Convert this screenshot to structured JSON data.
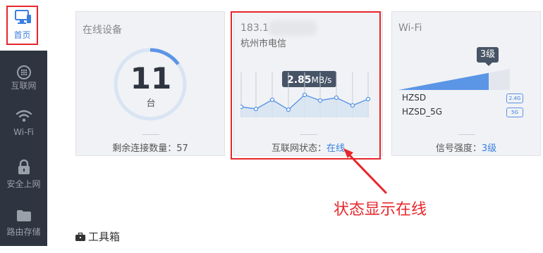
{
  "sidebar": {
    "items": [
      {
        "label": "首页",
        "icon": "monitor-icon",
        "active": true
      },
      {
        "label": "互联网",
        "icon": "globe-icon",
        "active": false
      },
      {
        "label": "Wi-Fi",
        "icon": "wifi-icon",
        "active": false
      },
      {
        "label": "安全上网",
        "icon": "lock-icon",
        "active": false
      },
      {
        "label": "路由存储",
        "icon": "folder-icon",
        "active": false
      }
    ],
    "active_color": "#3a7fe0",
    "background": "#2f3540"
  },
  "devices_card": {
    "title": "在线设备",
    "count": "11",
    "unit": "台",
    "remaining_label": "剩余连接数量：",
    "remaining_value": "57"
  },
  "internet_card": {
    "ip": "183.1",
    "isp": "杭州市电信",
    "speed_value": "2.85",
    "speed_unit": "MB/s",
    "status_label": "互联网状态：",
    "status_value": "在线"
  },
  "wifi_card": {
    "title": "Wi-Fi",
    "level_badge": "3级",
    "networks": [
      {
        "ssid": "HZSD",
        "band": "2.4G"
      },
      {
        "ssid": "HZSD_5G",
        "band": "5G"
      }
    ],
    "strength_label": "信号强度：",
    "strength_value": "3级"
  },
  "toolbox": {
    "label": "工具箱"
  },
  "annotation": {
    "text": "状态显示在线"
  },
  "colors": {
    "accent": "#3a7fe0",
    "highlight": "#e8262b"
  }
}
